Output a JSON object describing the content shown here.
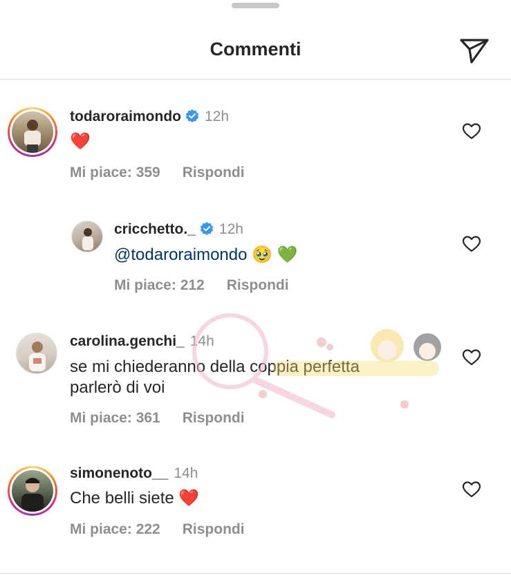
{
  "header": {
    "title": "Commenti",
    "share_icon": "paper-plane-icon"
  },
  "comments": [
    {
      "username": "todaroraimondo",
      "verified": true,
      "time": "12h",
      "text": "❤️",
      "likes": "Mi piace: 359",
      "reply": "Rispondi"
    },
    {
      "username": "cricchetto._",
      "verified": true,
      "time": "12h",
      "mention": "@todaroraimondo",
      "text": " 🥹 💚",
      "likes": "Mi piace: 212",
      "reply": "Rispondi"
    },
    {
      "username": "carolina.genchi_",
      "verified": false,
      "time": "14h",
      "text_line1": "se mi chiederanno della coppia perfetta",
      "text_line2": "parlerò di voi",
      "likes": "Mi piace: 361",
      "reply": "Rispondi"
    },
    {
      "username": "simonenoto__",
      "verified": false,
      "time": "14h",
      "text": "Che belli siete ❤️",
      "likes": "Mi piace: 222",
      "reply": "Rispondi"
    }
  ],
  "colors": {
    "verified": "#3897f0",
    "mention": "#00376b",
    "secondary": "#8e8e8e"
  }
}
